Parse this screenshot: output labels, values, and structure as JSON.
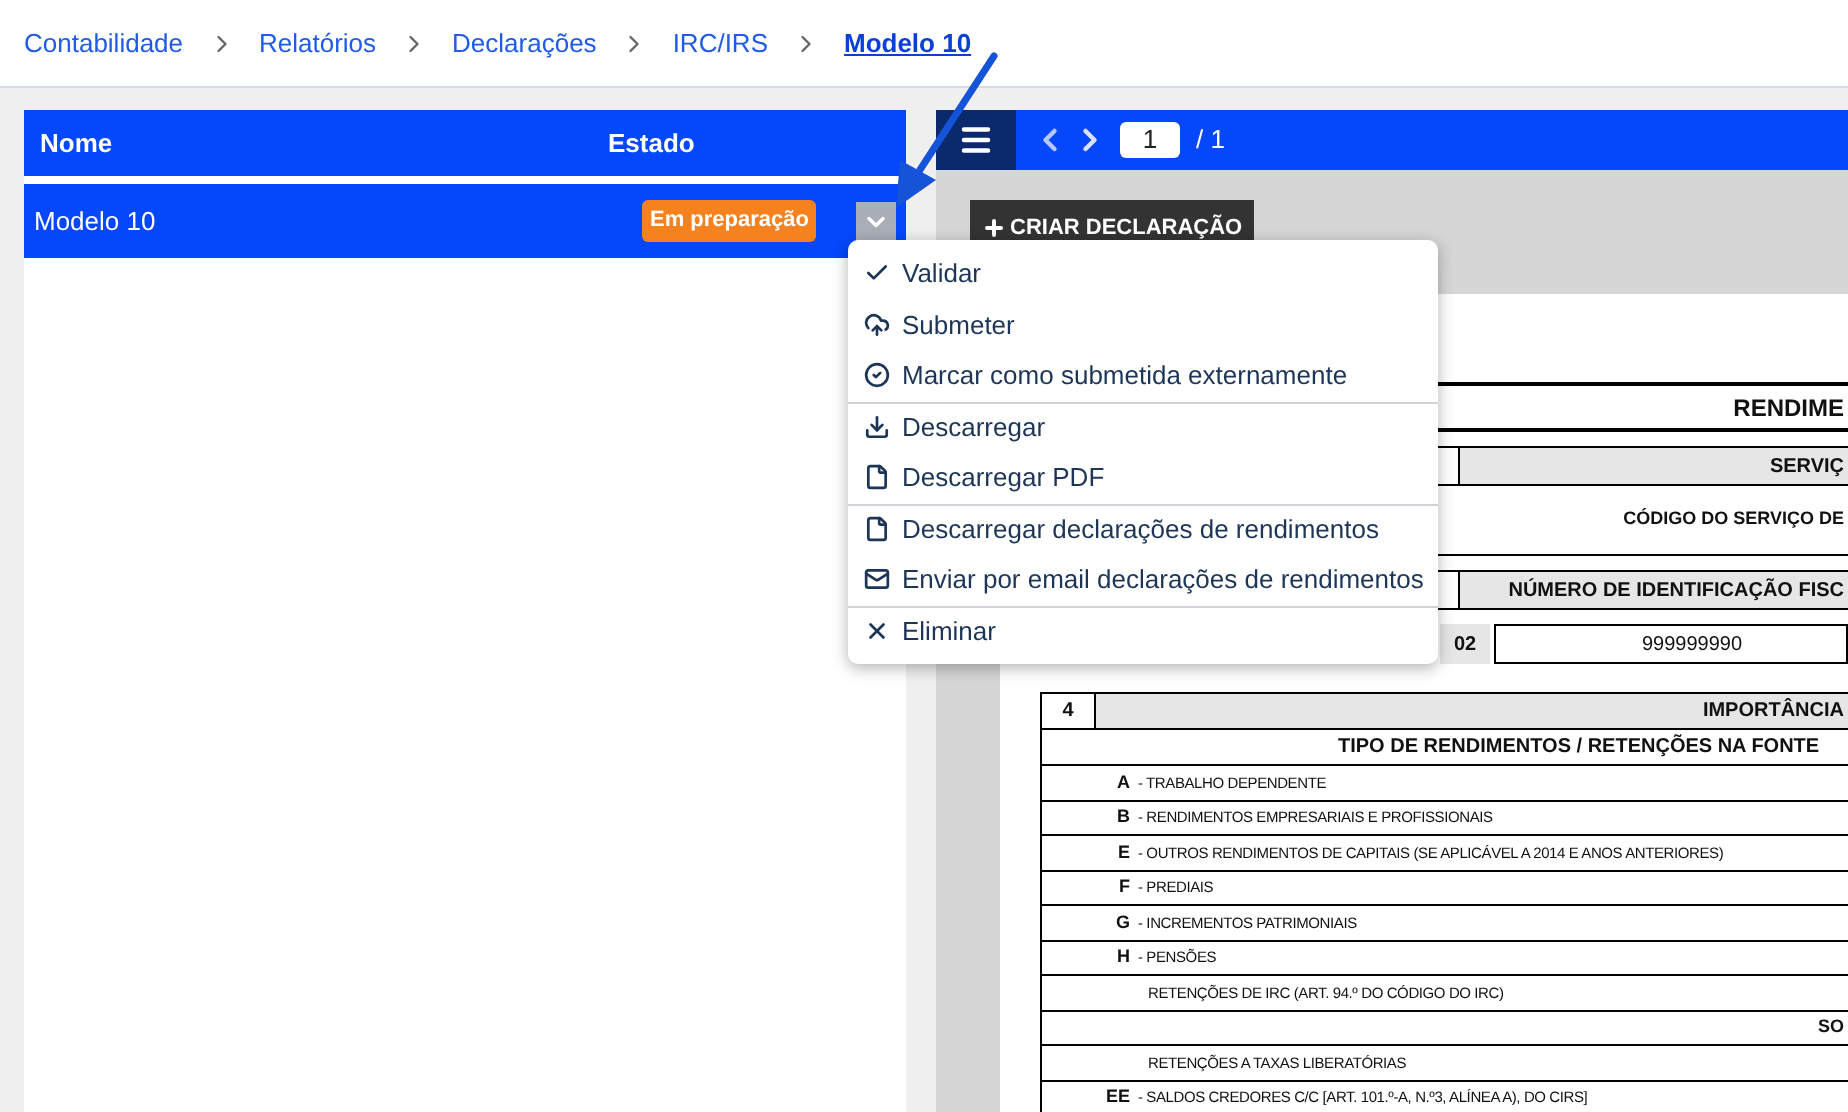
{
  "breadcrumb": [
    {
      "label": "Contabilidade",
      "selected": false
    },
    {
      "label": "Relatórios",
      "selected": false
    },
    {
      "label": "Declarações",
      "selected": false
    },
    {
      "label": "IRC/IRS",
      "selected": false
    },
    {
      "label": "Modelo 10",
      "selected": true
    }
  ],
  "list": {
    "columns": [
      "Nome",
      "Estado"
    ],
    "rows": [
      {
        "name": "Modelo 10",
        "status": "Em preparação",
        "selected": true
      }
    ]
  },
  "viewer": {
    "page": "1",
    "total": "/ 1",
    "create_button": "CRIAR DECLARAÇÃO"
  },
  "menu": [
    {
      "label": "Validar",
      "kind": "check",
      "divider_before": false
    },
    {
      "label": "Submeter",
      "kind": "upload",
      "divider_before": false
    },
    {
      "label": "Marcar como submetida externamente",
      "kind": "mark",
      "divider_before": false
    },
    {
      "label": "Descarregar",
      "kind": "download",
      "divider_before": true
    },
    {
      "label": "Descarregar PDF",
      "kind": "file",
      "divider_before": false
    },
    {
      "label": "Descarregar declarações de rendimentos",
      "kind": "file",
      "divider_before": true
    },
    {
      "label": "Enviar por email declarações de rendimentos",
      "kind": "mail",
      "divider_before": false
    },
    {
      "label": "Eliminar",
      "kind": "delete",
      "divider_before": true
    }
  ],
  "document": {
    "title": "RENDIME",
    "service_header": "SERVIÇ",
    "service_code_label": "CÓDIGO DO SERVIÇO DE",
    "nif_header": "NÚMERO DE IDENTIFICAÇÃO FISC",
    "nif_field": "02",
    "nif_value": "999999990",
    "section": {
      "number": "4",
      "title": "IMPORTÂNCIA",
      "subtitle": "TIPO DE RENDIMENTOS / RETENÇÕES NA FONTE",
      "rows": [
        {
          "kind": "coded",
          "code": "A",
          "label": "- TRABALHO DEPENDENTE"
        },
        {
          "kind": "coded",
          "code": "B",
          "label": "- RENDIMENTOS EMPRESARIAIS E PROFISSIONAIS"
        },
        {
          "kind": "coded",
          "code": "E",
          "label": "- OUTROS RENDIMENTOS DE CAPITAIS (SE APLICÁVEL A 2014 E ANOS ANTERIORES)"
        },
        {
          "kind": "coded",
          "code": "F",
          "label": "- PREDIAIS"
        },
        {
          "kind": "coded",
          "code": "G",
          "label": "- INCREMENTOS PATRIMONIAIS"
        },
        {
          "kind": "coded",
          "code": "H",
          "label": "- PENSÕES"
        },
        {
          "kind": "plain",
          "label": "RETENÇÕES DE IRC (ART. 94.º DO CÓDIGO DO IRC)"
        },
        {
          "kind": "total",
          "label": "SO"
        },
        {
          "kind": "plain",
          "label": "RETENÇÕES A TAXAS LIBERATÓRIAS"
        },
        {
          "kind": "coded",
          "code": "EE",
          "label": "- SALDOS CREDORES C/C [ART. 101.º-A, N.º3, ALÍNEA A), DO CIRS]"
        }
      ]
    }
  }
}
